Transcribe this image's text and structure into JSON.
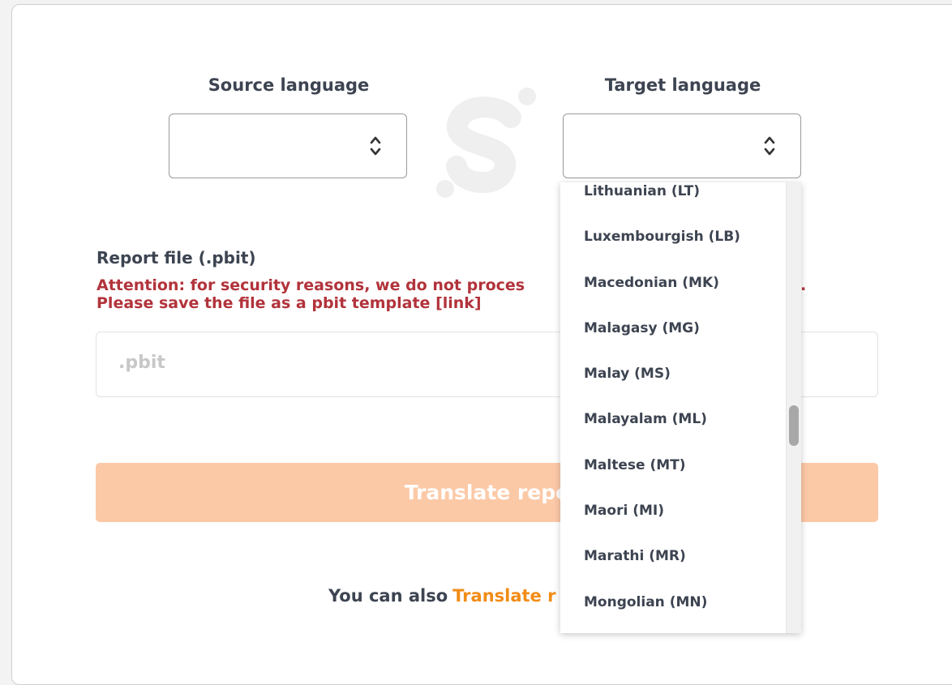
{
  "form": {
    "source_language_label": "Source language",
    "target_language_label": "Target language",
    "source_language_value": "",
    "target_language_value": "",
    "report_file_label": "Report file (.pbit)",
    "attention_line1": "Attention: for security reasons, we do not proces",
    "attention_line1_end": ".",
    "attention_line2": "Please save the file as a pbit template ",
    "attention_link": "[link]",
    "file_placeholder": ".pbit",
    "translate_button": "Translate repo",
    "also_text": "You can also",
    "also_link": "Translate r"
  },
  "dropdown": {
    "options": [
      "Lithuanian (LT)",
      "Luxembourgish (LB)",
      "Macedonian (MK)",
      "Malagasy (MG)",
      "Malay (MS)",
      "Malayalam (ML)",
      "Maltese (MT)",
      "Maori (MI)",
      "Marathi (MR)",
      "Mongolian (MN)"
    ]
  },
  "colors": {
    "text": "#3d4451",
    "attention": "#b2333b",
    "button_bg": "#fcc9a7",
    "link_orange": "#f28c17"
  },
  "icons": {
    "select_chevron": "chevron-up-down-icon",
    "logo": "brand-logo-icon"
  }
}
